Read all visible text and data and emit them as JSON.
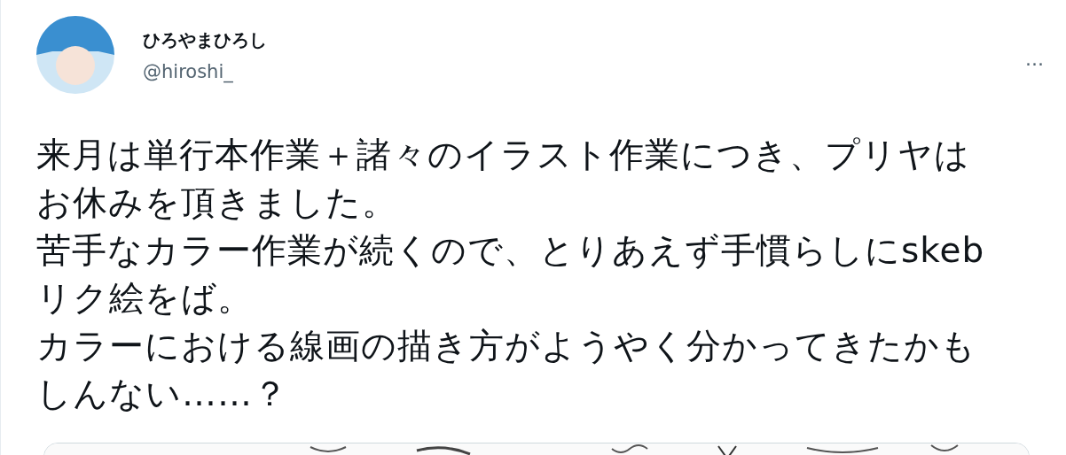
{
  "author": {
    "name": "ひろやまひろし",
    "handle": "@hiroshi_"
  },
  "more_button": "···",
  "tweet_lines": [
    "来月は単行本作業＋諸々のイラスト作業につき、プリヤは",
    "お休みを頂きました。",
    "苦手なカラー作業が続くので、とりあえず手慣らしにskeb",
    "リク絵をば。",
    "カラーにおける線画の描き方がようやく分かってきたかも",
    "しんない……？"
  ]
}
